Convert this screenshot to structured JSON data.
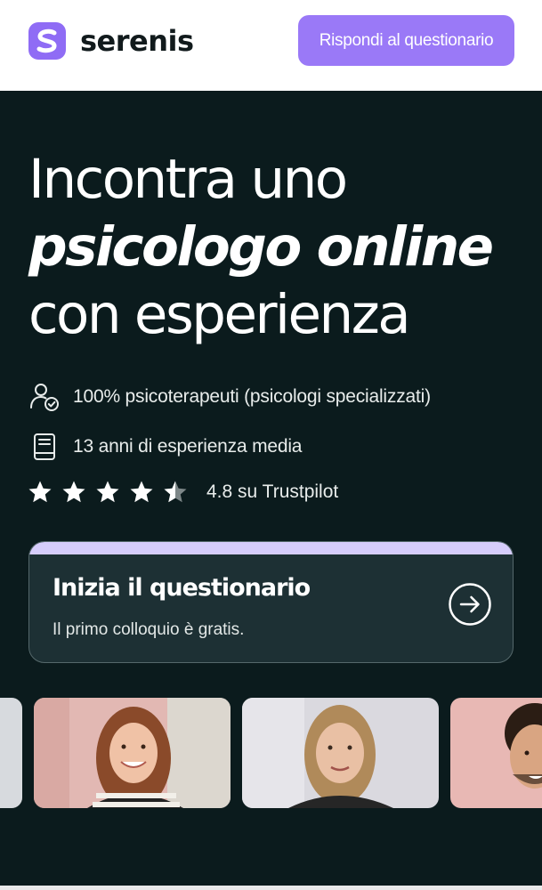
{
  "brand": {
    "name": "serenis",
    "accent": "#9a79f7",
    "logo_icon": "serenis-s-logo-icon"
  },
  "header": {
    "cta_label": "Rispondi al questionario"
  },
  "hero": {
    "bg_color": "#0b1b1d",
    "headline": {
      "line1": "Incontra uno",
      "line2": "psicologo online",
      "line3": "con esperienza"
    },
    "features": [
      {
        "icon": "user-check-icon",
        "text": "100% psicoterapeuti (psicologi specializzati)"
      },
      {
        "icon": "book-icon",
        "text": "13 anni di esperienza media"
      }
    ],
    "rating": {
      "stars": 4.5,
      "text": "4.8 su Trustpilot"
    }
  },
  "questionnaire_card": {
    "title": "Inizia il questionario",
    "subtitle": "Il primo colloquio è gratis.",
    "icon": "arrow-right-circle-icon"
  },
  "therapist_photos": [
    {
      "name": "therapist-photo-partial-left"
    },
    {
      "name": "therapist-photo-woman-curly-hair"
    },
    {
      "name": "therapist-photo-woman-blonde"
    },
    {
      "name": "therapist-photo-man-partial-right"
    }
  ]
}
